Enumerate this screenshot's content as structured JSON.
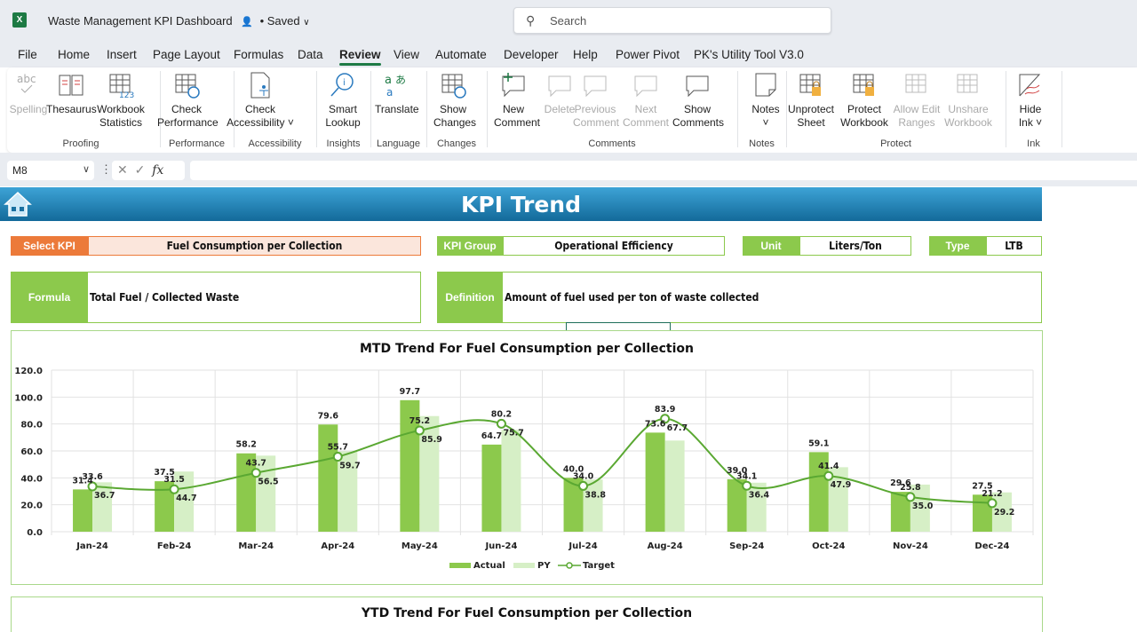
{
  "window": {
    "app_icon": "excel-icon",
    "title": "Waste Management KPI Dashboard",
    "share_icon": "share-person-icon",
    "save_status": "• Saved",
    "search_placeholder": "Search"
  },
  "menu": [
    "File",
    "Home",
    "Insert",
    "Page Layout",
    "Formulas",
    "Data",
    "Review",
    "View",
    "Automate",
    "Developer",
    "Help",
    "Power Pivot",
    "PK's Utility Tool V3.0"
  ],
  "active_menu": "Review",
  "ribbon": {
    "groups": [
      {
        "name": "Proofing",
        "buttons": [
          {
            "l1": "Spelling",
            "l2": "",
            "icon": "spelling-icon",
            "disabled": true
          },
          {
            "l1": "Thesaurus",
            "l2": "",
            "icon": "thesaurus-icon"
          },
          {
            "l1": "Workbook",
            "l2": "Statistics",
            "icon": "workbook-statistics-icon"
          }
        ]
      },
      {
        "name": "Performance",
        "buttons": [
          {
            "l1": "Check",
            "l2": "Performance",
            "icon": "check-performance-icon"
          }
        ]
      },
      {
        "name": "Accessibility",
        "buttons": [
          {
            "l1": "Check",
            "l2": "Accessibility ˅",
            "icon": "check-accessibility-icon"
          }
        ]
      },
      {
        "name": "Insights",
        "buttons": [
          {
            "l1": "Smart",
            "l2": "Lookup",
            "icon": "smart-lookup-icon"
          }
        ]
      },
      {
        "name": "Language",
        "buttons": [
          {
            "l1": "Translate",
            "l2": "",
            "icon": "translate-icon"
          }
        ]
      },
      {
        "name": "Changes",
        "buttons": [
          {
            "l1": "Show",
            "l2": "Changes",
            "icon": "show-changes-icon"
          }
        ]
      },
      {
        "name": "Comments",
        "buttons": [
          {
            "l1": "New",
            "l2": "Comment",
            "icon": "new-comment-icon"
          },
          {
            "l1": "Delete",
            "l2": "",
            "icon": "delete-comment-icon",
            "disabled": true
          },
          {
            "l1": "Previous",
            "l2": "Comment",
            "icon": "previous-comment-icon",
            "disabled": true
          },
          {
            "l1": "Next",
            "l2": "Comment",
            "icon": "next-comment-icon",
            "disabled": true
          },
          {
            "l1": "Show",
            "l2": "Comments",
            "icon": "show-comments-icon"
          }
        ]
      },
      {
        "name": "Notes",
        "buttons": [
          {
            "l1": "Notes",
            "l2": "˅",
            "icon": "notes-icon"
          }
        ]
      },
      {
        "name": "Protect",
        "buttons": [
          {
            "l1": "Unprotect",
            "l2": "Sheet",
            "icon": "unprotect-sheet-icon"
          },
          {
            "l1": "Protect",
            "l2": "Workbook",
            "icon": "protect-workbook-icon"
          },
          {
            "l1": "Allow Edit",
            "l2": "Ranges",
            "icon": "allow-edit-ranges-icon",
            "disabled": true
          },
          {
            "l1": "Unshare",
            "l2": "Workbook",
            "icon": "unshare-workbook-icon",
            "disabled": true
          }
        ]
      },
      {
        "name": "Ink",
        "buttons": [
          {
            "l1": "Hide",
            "l2": "Ink ˅",
            "icon": "hide-ink-icon"
          }
        ]
      }
    ]
  },
  "formula_bar": {
    "name_box": "M8",
    "fx": "fx",
    "formula": ""
  },
  "dashboard": {
    "title": "KPI Trend",
    "select_kpi_label": "Select KPI",
    "select_kpi_value": "Fuel Consumption per Collection",
    "kpi_group_label": "KPI Group",
    "kpi_group_value": "Operational Efficiency",
    "unit_label": "Unit",
    "unit_value": "Liters/Ton",
    "type_label": "Type",
    "type_value": "LTB",
    "formula_label": "Formula",
    "formula_value": "Total Fuel / Collected Waste",
    "definition_label": "Definition",
    "definition_value": "Amount of fuel used per ton of waste collected",
    "ytd_title": "YTD Trend For Fuel Consumption per Collection"
  },
  "colors": {
    "actual": "#8cc94c",
    "py": "#d6efc6",
    "target": "#5aa832",
    "header_orange": "#ec7a3a",
    "header_green": "#8cc94c"
  },
  "chart_data": {
    "type": "bar",
    "title": "MTD Trend For Fuel Consumption per Collection",
    "categories": [
      "Jan-24",
      "Feb-24",
      "Mar-24",
      "Apr-24",
      "May-24",
      "Jun-24",
      "Jul-24",
      "Aug-24",
      "Sep-24",
      "Oct-24",
      "Nov-24",
      "Dec-24"
    ],
    "series": [
      {
        "name": "Actual",
        "type": "bar",
        "values": [
          31.4,
          37.5,
          58.2,
          79.6,
          97.7,
          64.7,
          40.0,
          73.6,
          39.0,
          59.1,
          29.6,
          27.5
        ]
      },
      {
        "name": "PY",
        "type": "bar",
        "values": [
          36.7,
          44.7,
          56.5,
          59.7,
          85.9,
          75.7,
          38.8,
          67.7,
          36.4,
          47.9,
          35.0,
          29.2
        ]
      },
      {
        "name": "Target",
        "type": "line",
        "values": [
          33.6,
          31.5,
          43.7,
          55.7,
          75.2,
          80.2,
          34.0,
          83.9,
          34.1,
          41.4,
          25.8,
          21.2
        ]
      }
    ],
    "ylim": [
      0,
      120
    ],
    "yticks": [
      "0.0",
      "20.0",
      "40.0",
      "60.0",
      "80.0",
      "100.0",
      "120.0"
    ],
    "xlabel": "",
    "ylabel": "",
    "grid": true,
    "legend": "bottom"
  }
}
